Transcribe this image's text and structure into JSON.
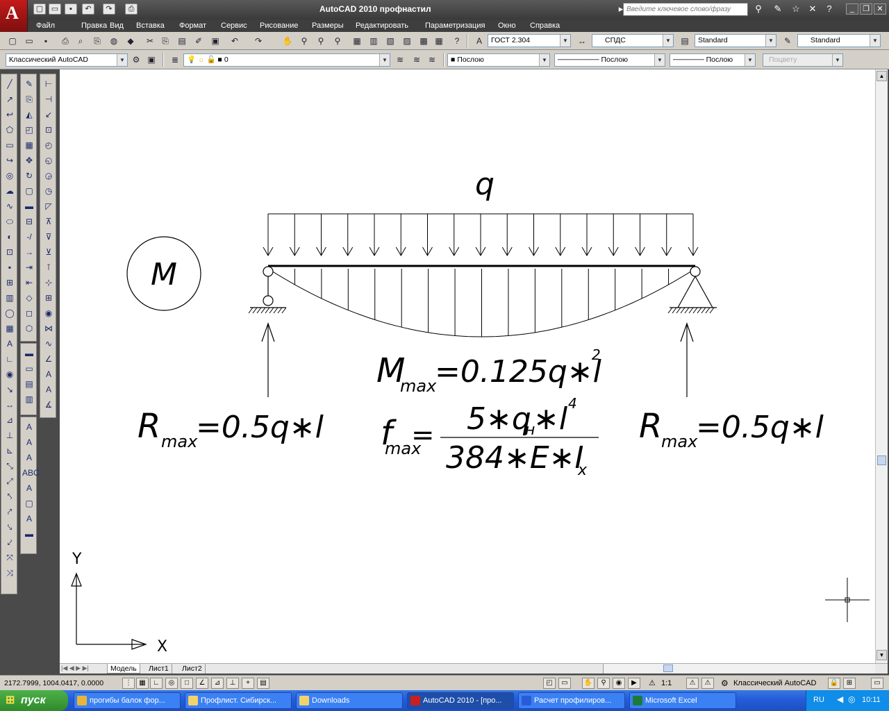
{
  "window": {
    "title": "AutoCAD 2010   профнастил",
    "search_placeholder": "Введите ключевое слово/фразу"
  },
  "menu": [
    "Файл",
    "Правка",
    "Вид",
    "Вставка",
    "Формат",
    "Сервис",
    "Рисование",
    "Размеры",
    "Редактировать",
    "Параметризация",
    "Окно",
    "Справка"
  ],
  "toolbar2": {
    "text_style": "ГОСТ 2.304",
    "dim_style": "СПДС",
    "table_style": "Standard",
    "mleader_style": "Standard"
  },
  "toolbar3": {
    "workspace": "Классический AutoCAD",
    "layer": "0",
    "color": "Послою",
    "linetype": "Послою",
    "lineweight": "Послою",
    "plotstyle": "Поцвету"
  },
  "drawing": {
    "load_label": "q",
    "moment_label": "M",
    "mmax_formula": {
      "main": "M",
      "sub": "max",
      "rest": "=0.125q∗l",
      "sup": "2"
    },
    "rmax_left": {
      "main": "R",
      "sub": "max",
      "rest": "=0.5q∗l"
    },
    "rmax_right": {
      "main": "R",
      "sub": "max",
      "rest": "=0.5q∗l"
    },
    "fmax_formula": {
      "main": "f",
      "sub": "max",
      "eq": "=",
      "numerator": "5∗q",
      "num_sub": "н",
      "num_rest": "∗l",
      "num_sup": "4",
      "denominator": "384∗E∗I",
      "den_sub": "x"
    },
    "ucs": {
      "y": "Y",
      "x": "X"
    }
  },
  "layout_tabs": [
    "Модель",
    "Лист1",
    "Лист2"
  ],
  "status": {
    "coordinates": "2172.7999, 1004.0417, 0.0000",
    "scale": "1:1",
    "workspace": "Классический AutoCAD"
  },
  "taskbar": {
    "start": "пуск",
    "tasks": [
      {
        "label": "прогибы балок фор...",
        "color": "#e8b43a"
      },
      {
        "label": "Профлист. Сибирск...",
        "color": "#f2d36b"
      },
      {
        "label": "Downloads",
        "color": "#f2d36b"
      },
      {
        "label": "AutoCAD 2010 - [про...",
        "color": "#c8201e"
      },
      {
        "label": "Расчет профилиров...",
        "color": "#2a5bd7"
      },
      {
        "label": "Microsoft Excel",
        "color": "#1e7a3a"
      }
    ],
    "lang": "RU",
    "clock": "10:11"
  }
}
